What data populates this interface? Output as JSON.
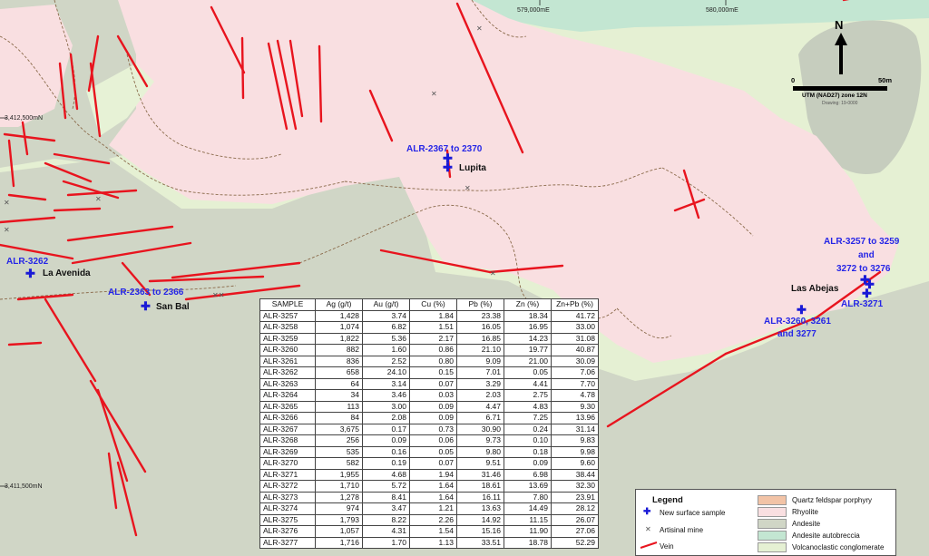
{
  "map": {
    "grid_labels": {
      "e1": "579,000mE",
      "e2": "580,000mE",
      "n1": "3,412,500mN",
      "n2": "3,411,500mN"
    },
    "north_arrow": "N",
    "scale": {
      "zero": "0",
      "end": "50m",
      "projection": "UTM (NAD27) zone 12N",
      "drawing": "Drawing: 19-0000"
    },
    "sample_labels": {
      "alr2367": "ALR-2367 to 2370",
      "alr3262": "ALR-3262",
      "alr2363": "ALR-2363 to 2366",
      "alr3257_a": "ALR-3257 to 3259",
      "alr3257_b": "and",
      "alr3257_c": "3272 to 3276",
      "alr3271": "ALR-3271",
      "alr3260_a": "ALR-3260, 3261",
      "alr3260_b": "and 3277"
    },
    "place_labels": {
      "lupita": "Lupita",
      "la_avenida": "La Avenida",
      "san_bal": "San Bal",
      "las_abejas": "Las Abejas"
    },
    "colors": {
      "rhyolite": "#f9dfe1",
      "andesite": "#d0d6c6",
      "andesite_autobreccia": "#c3e6d2",
      "volcaniclastic": "#e5f0d3",
      "porphyry": "#f2c3a6",
      "vein": "#e8141e",
      "sample": "#1a1ad6"
    }
  },
  "table": {
    "headers": [
      "SAMPLE",
      "Ag (g/t)",
      "Au (g/t)",
      "Cu (%)",
      "Pb (%)",
      "Zn (%)",
      "Zn+Pb (%)"
    ],
    "rows": [
      [
        "ALR-3257",
        "1,428",
        "3.74",
        "1.84",
        "23.38",
        "18.34",
        "41.72"
      ],
      [
        "ALR-3258",
        "1,074",
        "6.82",
        "1.51",
        "16.05",
        "16.95",
        "33.00"
      ],
      [
        "ALR-3259",
        "1,822",
        "5.36",
        "2.17",
        "16.85",
        "14.23",
        "31.08"
      ],
      [
        "ALR-3260",
        "882",
        "1.60",
        "0.86",
        "21.10",
        "19.77",
        "40.87"
      ],
      [
        "ALR-3261",
        "836",
        "2.52",
        "0.80",
        "9.09",
        "21.00",
        "30.09"
      ],
      [
        "ALR-3262",
        "658",
        "24.10",
        "0.15",
        "7.01",
        "0.05",
        "7.06"
      ],
      [
        "ALR-3263",
        "64",
        "3.14",
        "0.07",
        "3.29",
        "4.41",
        "7.70"
      ],
      [
        "ALR-3264",
        "34",
        "3.46",
        "0.03",
        "2.03",
        "2.75",
        "4.78"
      ],
      [
        "ALR-3265",
        "113",
        "3.00",
        "0.09",
        "4.47",
        "4.83",
        "9.30"
      ],
      [
        "ALR-3266",
        "84",
        "2.08",
        "0.09",
        "6.71",
        "7.25",
        "13.96"
      ],
      [
        "ALR-3267",
        "3,675",
        "0.17",
        "0.73",
        "30.90",
        "0.24",
        "31.14"
      ],
      [
        "ALR-3268",
        "256",
        "0.09",
        "0.06",
        "9.73",
        "0.10",
        "9.83"
      ],
      [
        "ALR-3269",
        "535",
        "0.16",
        "0.05",
        "9.80",
        "0.18",
        "9.98"
      ],
      [
        "ALR-3270",
        "582",
        "0.19",
        "0.07",
        "9.51",
        "0.09",
        "9.60"
      ],
      [
        "ALR-3271",
        "1,955",
        "4.68",
        "1.94",
        "31.46",
        "6.98",
        "38.44"
      ],
      [
        "ALR-3272",
        "1,710",
        "5.72",
        "1.64",
        "18.61",
        "13.69",
        "32.30"
      ],
      [
        "ALR-3273",
        "1,278",
        "8.41",
        "1.64",
        "16.11",
        "7.80",
        "23.91"
      ],
      [
        "ALR-3274",
        "974",
        "3.47",
        "1.21",
        "13.63",
        "14.49",
        "28.12"
      ],
      [
        "ALR-3275",
        "1,793",
        "8.22",
        "2.26",
        "14.92",
        "11.15",
        "26.07"
      ],
      [
        "ALR-3276",
        "1,057",
        "4.31",
        "1.54",
        "15.16",
        "11.90",
        "27.06"
      ],
      [
        "ALR-3277",
        "1,716",
        "1.70",
        "1.13",
        "33.51",
        "18.78",
        "52.29"
      ]
    ]
  },
  "legend": {
    "title": "Legend",
    "new_sample": "New surface sample",
    "artisinal_mine": "Artisinal mine",
    "vein": "Vein",
    "porphyry": "Quartz feldspar porphyry",
    "rhyolite": "Rhyolite",
    "andesite": "Andesite",
    "andesite_autobreccia": "Andesite autobreccia",
    "volcaniclastic": "Volcanoclastic conglomerate"
  }
}
